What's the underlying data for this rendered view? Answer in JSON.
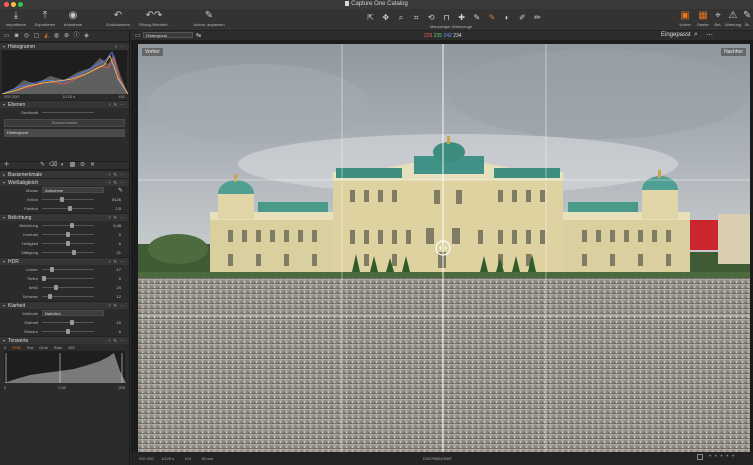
{
  "app": {
    "window_title": "Capture One Catalog"
  },
  "toolbar": {
    "items": [
      {
        "icon": "import-icon",
        "glyph": "⤓",
        "label": "Importieren"
      },
      {
        "icon": "export-icon",
        "glyph": "⤒",
        "label": "Exportieren"
      },
      {
        "icon": "camera-icon",
        "glyph": "◉",
        "label": "Aufnahme"
      },
      {
        "icon": "undo-icon",
        "glyph": "↶",
        "label": "Zurücksetzen"
      },
      {
        "icon": "undo-redo-icon",
        "glyph": "↶↷",
        "label": "Rückg./Wiederh."
      },
      {
        "icon": "auto-adjust-icon",
        "glyph": "✎",
        "label": "Autom. anpassen"
      }
    ],
    "tools_label": "Mauszeiger-Werkzeuge",
    "right_items": [
      {
        "icon": "before-icon",
        "label": "Vorher"
      },
      {
        "icon": "viewer-icon",
        "label": "Raster"
      },
      {
        "icon": "focus-icon",
        "label": "Bel."
      },
      {
        "icon": "warning-icon",
        "label": "Warnung"
      },
      {
        "icon": "sketch-icon",
        "label": "Sk"
      }
    ]
  },
  "panel": {
    "histogram": {
      "title": "Histogramm",
      "iso": "ISO 200",
      "shutter": "1/120 s",
      "aperture": "f/11"
    },
    "layers": {
      "title": "Ebenen",
      "opacity_label": "Deckkraft",
      "add_button": "Ebenenmaske",
      "active_layer": "Hintergrund"
    },
    "basics_title": "Basismerkmale",
    "wb": {
      "title": "Weißabgleich",
      "mode_label": "Modus",
      "mode_value": "Aufnahme",
      "kelvin_label": "Kelvin",
      "kelvin_value": "5126",
      "tint_label": "Farbton",
      "tint_value": "2,5"
    },
    "exposure": {
      "title": "Belichtung",
      "rows": [
        {
          "label": "Belichtung",
          "value": "0,48"
        },
        {
          "label": "Kontrast",
          "value": "0"
        },
        {
          "label": "Helligkeit",
          "value": "0"
        },
        {
          "label": "Sättigung",
          "value": "21"
        }
      ]
    },
    "hdr": {
      "title": "HDR",
      "rows": [
        {
          "label": "Lichter",
          "value": "-17"
        },
        {
          "label": "Tiefen",
          "value": "0"
        },
        {
          "label": "Weiß",
          "value": "24"
        },
        {
          "label": "Schwarz",
          "value": "12"
        }
      ]
    },
    "clarity": {
      "title": "Klarheit",
      "method_label": "Methode",
      "method_value": "Natürlich",
      "rows": [
        {
          "label": "Klarheit",
          "value": "10"
        },
        {
          "label": "Struktur",
          "value": "0"
        }
      ]
    },
    "levels": {
      "title": "Tonwerte",
      "tabs": [
        "RGB",
        "Rot",
        "Grün",
        "Blau"
      ],
      "left_value": "0",
      "right_value": "255",
      "bottom_left": "0",
      "bottom_mid": "0,00",
      "bottom_right": "255"
    }
  },
  "viewer": {
    "rgb": {
      "r": "229",
      "g": "235",
      "b": "242",
      "l": "234"
    },
    "fit_label": "Eingepasst",
    "variant_name": "Hintergrund",
    "before_label": "Vorher",
    "after_label": "Nachher",
    "status": {
      "iso": "ISO 200",
      "shutter": "1/125 s",
      "aperture": "f/11",
      "focal": "18 mm",
      "filename": "DSCF6563.RAF"
    }
  },
  "colors": {
    "accent": "#e8741c",
    "panel_bg": "#2b2b2b",
    "viewer_bg": "#1c1c1c"
  }
}
